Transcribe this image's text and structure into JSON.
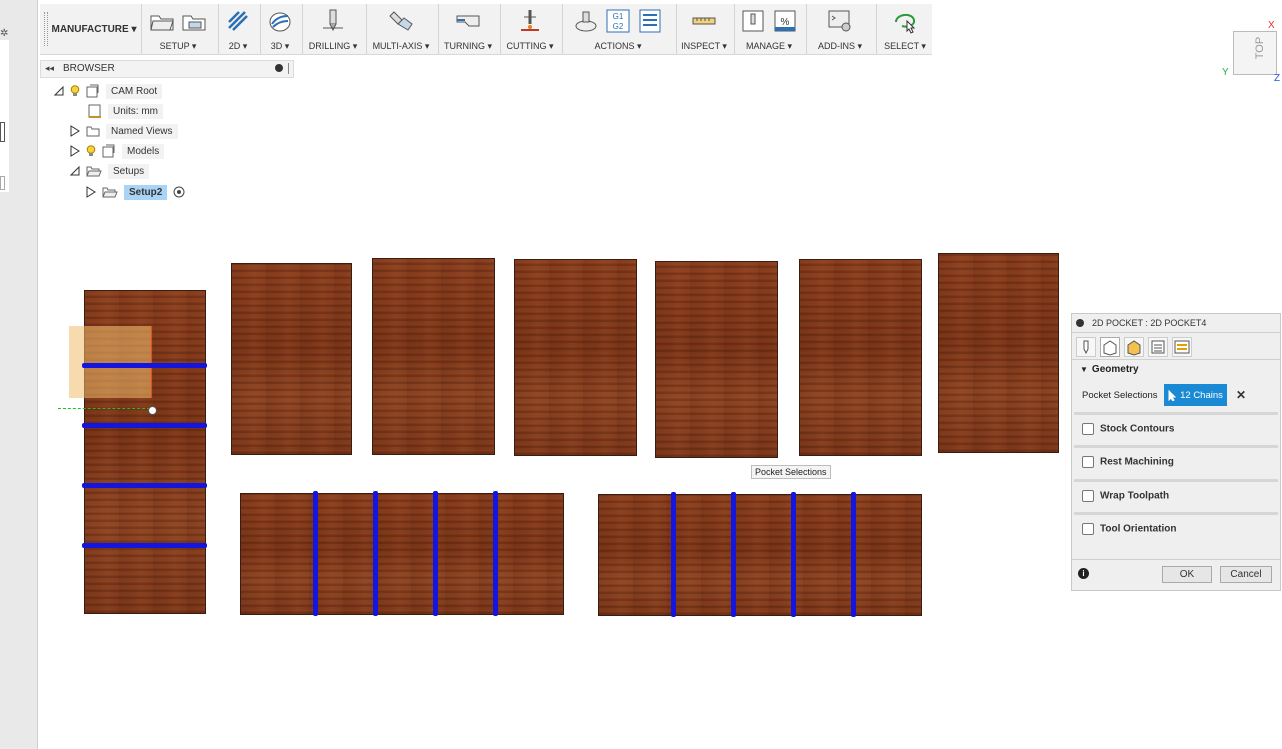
{
  "toolbar": {
    "workspace": "MANUFACTURE ▾",
    "groups": [
      {
        "label": "SETUP ▾"
      },
      {
        "label": "2D ▾"
      },
      {
        "label": "3D ▾"
      },
      {
        "label": "DRILLING ▾"
      },
      {
        "label": "MULTI-AXIS ▾"
      },
      {
        "label": "TURNING ▾"
      },
      {
        "label": "CUTTING ▾"
      },
      {
        "label": "ACTIONS ▾"
      },
      {
        "label": "INSPECT ▾"
      },
      {
        "label": "MANAGE ▾"
      },
      {
        "label": "ADD-INS ▾"
      },
      {
        "label": "SELECT ▾"
      }
    ],
    "g1g2_text": "G1 G2"
  },
  "browser": {
    "title": "BROWSER",
    "items": [
      {
        "label": "CAM Root"
      },
      {
        "label": "Units: mm"
      },
      {
        "label": "Named Views"
      },
      {
        "label": "Models"
      },
      {
        "label": "Setups"
      },
      {
        "label": "Setup2"
      }
    ]
  },
  "viewport": {
    "tooltip": "Pocket Selections"
  },
  "viewcube": {
    "face": "TOP",
    "axis_x": "X",
    "axis_y": "Y",
    "axis_z": "Z"
  },
  "dialog": {
    "title": "2D POCKET : 2D POCKET4",
    "section_geometry": "Geometry",
    "pocket_selections_label": "Pocket Selections",
    "chains_button": "12 Chains",
    "clear_symbol": "✕",
    "options": [
      {
        "label": "Stock Contours"
      },
      {
        "label": "Rest Machining"
      },
      {
        "label": "Wrap Toolpath"
      },
      {
        "label": "Tool Orientation"
      }
    ],
    "ok_label": "OK",
    "cancel_label": "Cancel",
    "info_symbol": "i",
    "accent_color": "#1a8ad4"
  },
  "colors": {
    "selection_blue": "#1515e0",
    "wood": "#7a3417"
  }
}
